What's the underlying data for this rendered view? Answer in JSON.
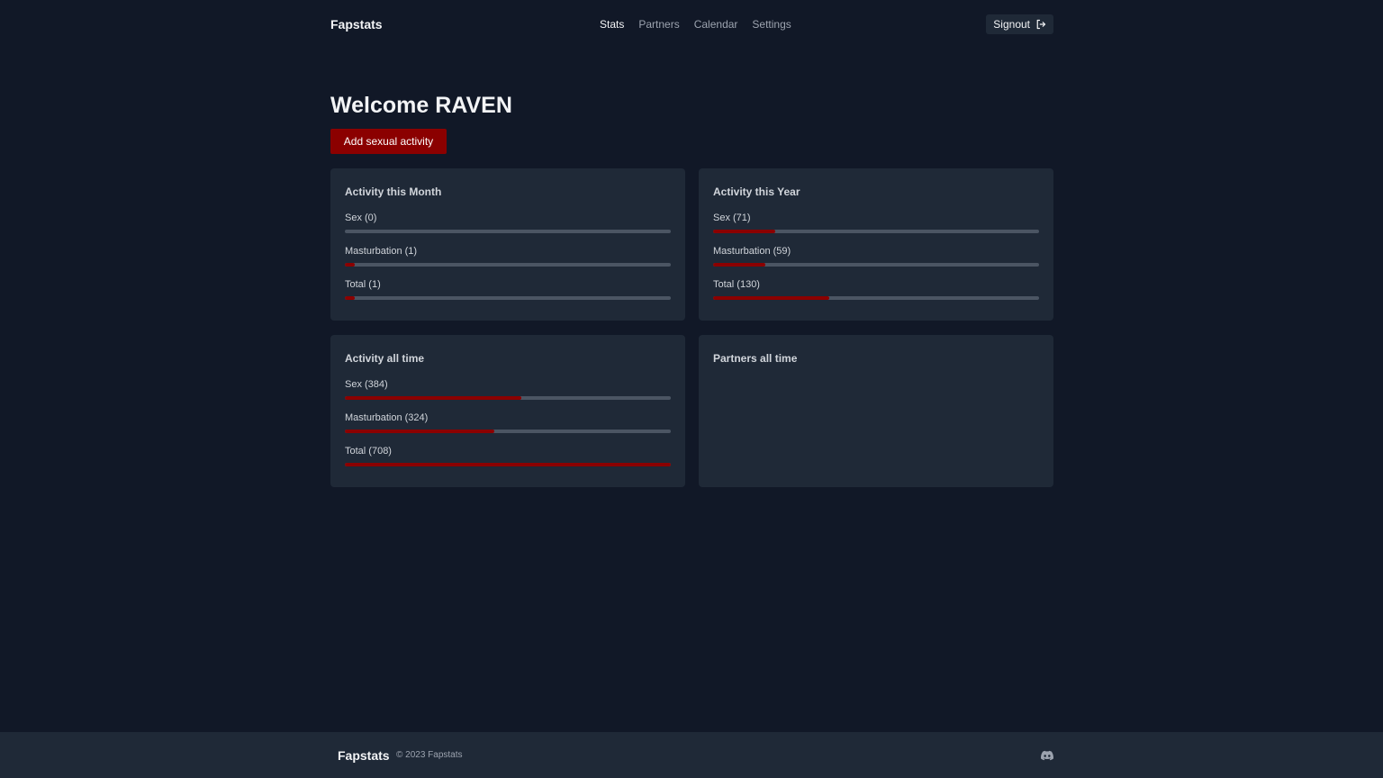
{
  "header": {
    "brand": "Fapstats",
    "nav": [
      {
        "label": "Stats",
        "active": true
      },
      {
        "label": "Partners",
        "active": false
      },
      {
        "label": "Calendar",
        "active": false
      },
      {
        "label": "Settings",
        "active": false
      }
    ],
    "signout_label": "Signout",
    "signout_icon": "sign-out-icon"
  },
  "main": {
    "welcome": "Welcome RAVEN",
    "add_button": "Add sexual activity",
    "cards": [
      {
        "title": "Activity this Month",
        "stats": [
          {
            "label": "Sex (0)",
            "fraction": 0.0
          },
          {
            "label": "Masturbation (1)",
            "fraction": 0.03
          },
          {
            "label": "Total (1)",
            "fraction": 0.03
          }
        ]
      },
      {
        "title": "Activity this Year",
        "stats": [
          {
            "label": "Sex (71)",
            "fraction": 0.19
          },
          {
            "label": "Masturbation (59)",
            "fraction": 0.16
          },
          {
            "label": "Total (130)",
            "fraction": 0.355
          }
        ]
      },
      {
        "title": "Activity all time",
        "stats": [
          {
            "label": "Sex (384)",
            "fraction": 0.542
          },
          {
            "label": "Masturbation (324)",
            "fraction": 0.458
          },
          {
            "label": "Total (708)",
            "fraction": 1.0
          }
        ]
      },
      {
        "title": "Partners all time",
        "stats": []
      }
    ]
  },
  "footer": {
    "brand": "Fapstats",
    "copyright": "© 2023 Fapstats",
    "discord_icon": "discord-icon"
  },
  "colors": {
    "background": "#111827",
    "card": "#1f2937",
    "accent": "#8b0000",
    "track": "#4b5563"
  }
}
